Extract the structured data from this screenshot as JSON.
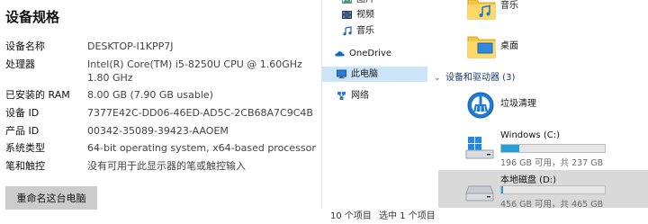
{
  "settings": {
    "title": "设备规格",
    "rows": [
      {
        "key": "设备名称",
        "value": "DESKTOP-I1KPP7J"
      },
      {
        "key": "处理器",
        "value": "Intel(R) Core(TM) i5-8250U CPU @ 1.60GHz   1.80 GHz"
      },
      {
        "key": "已安装的 RAM",
        "value": "8.00 GB (7.90 GB usable)"
      },
      {
        "key": "设备 ID",
        "value": "7377E42C-DD06-46ED-AD5C-2CB68A7C9C4B"
      },
      {
        "key": "产品 ID",
        "value": "00342-35089-39423-AAOEM"
      },
      {
        "key": "系统类型",
        "value": "64-bit operating system, x64-based processor"
      },
      {
        "key": "笔和触控",
        "value": "没有可用于此显示器的笔或触控输入"
      }
    ],
    "rename_button": "重命名这台电脑"
  },
  "nav": {
    "items": [
      {
        "label": "图片",
        "icon": "pictures-icon"
      },
      {
        "label": "视频",
        "icon": "videos-icon"
      },
      {
        "label": "音乐",
        "icon": "music-icon"
      },
      {
        "label": "OneDrive",
        "icon": "onedrive-icon"
      },
      {
        "label": "此电脑",
        "icon": "this-pc-icon",
        "selected": true
      },
      {
        "label": "网络",
        "icon": "network-icon"
      }
    ]
  },
  "content": {
    "folders": [
      {
        "label": "音乐",
        "icon": "music-folder-icon"
      },
      {
        "label": "桌面",
        "icon": "desktop-folder-icon"
      }
    ],
    "devices_header": "设备和驱动器 (3)",
    "app_label": "垃圾清理",
    "drives": [
      {
        "name": "Windows (C:)",
        "free_text": "196 GB 可用，共 237 GB",
        "used_fraction": 0.17,
        "icon": "windows-drive-icon"
      },
      {
        "name": "本地磁盘 (D:)",
        "free_text": "456 GB 可用，共 465 GB",
        "used_fraction": 0.02,
        "icon": "local-disk-icon",
        "selected": true
      }
    ]
  },
  "status_bar": {
    "item_count": "10 个项目",
    "selected_count": "选中 1 个项目"
  },
  "colors": {
    "nav_selected": "#cce4f7",
    "drive_bar_fill": "#26a0da",
    "folder_yellow": "#f6c543"
  }
}
